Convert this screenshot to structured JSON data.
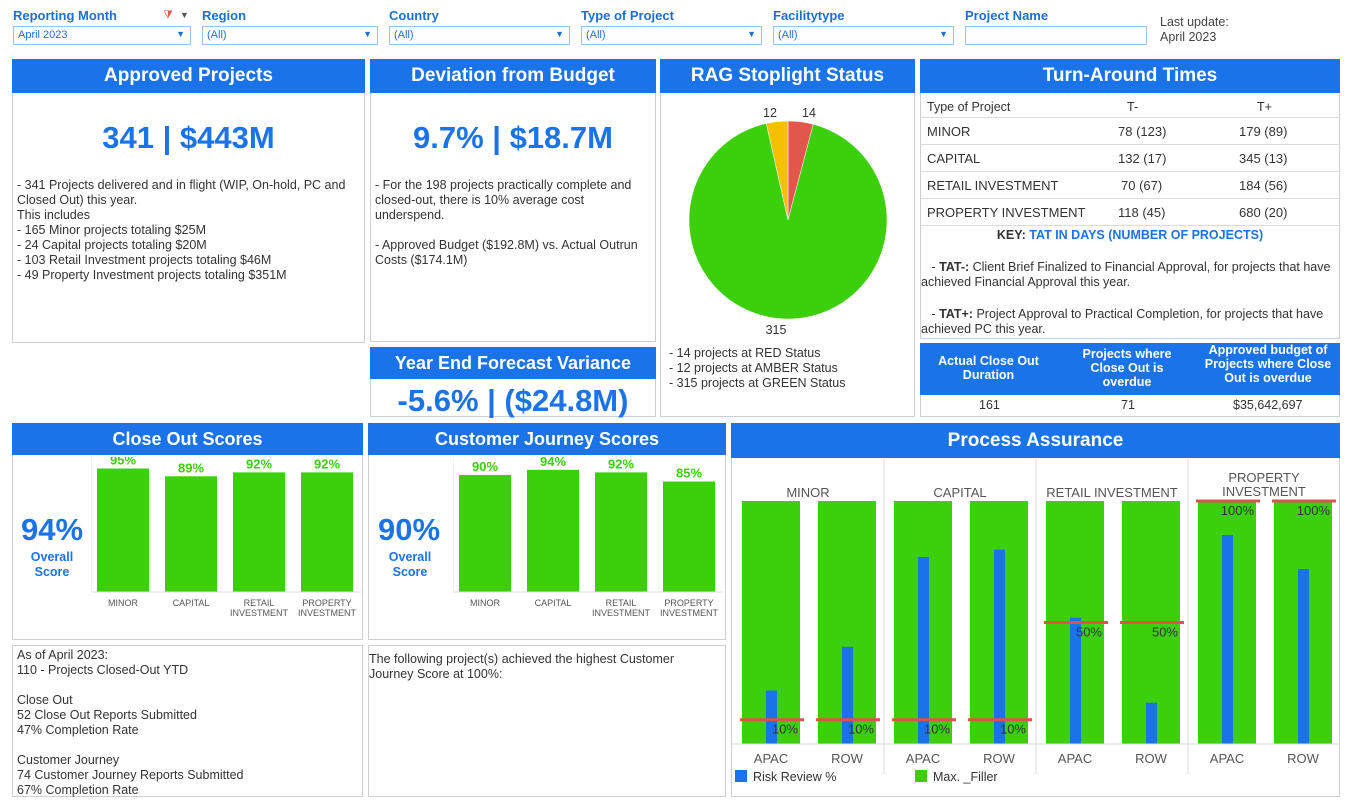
{
  "filters": [
    {
      "label": "Reporting Month",
      "value": "April 2023"
    },
    {
      "label": "Region",
      "value": "(All)"
    },
    {
      "label": "Country",
      "value": "(All)"
    },
    {
      "label": "Type of Project",
      "value": "(All)"
    },
    {
      "label": "Facilitytype",
      "value": "(All)"
    },
    {
      "label": "Project Name",
      "value": ""
    }
  ],
  "last_update": {
    "label": "Last update:",
    "value": "April 2023"
  },
  "approved": {
    "title": "Approved Projects",
    "kpi": "341 | $443M",
    "text": "- 341 Projects delivered and in flight (WIP, On-hold, PC and Closed Out) this year.\n This includes\n- 165 Minor projects totaling $25M\n- 24 Capital projects totaling $20M\n- 103 Retail Investment projects totaling $46M\n- 49 Property Investment projects totaling $351M"
  },
  "deviation": {
    "title": "Deviation from Budget",
    "kpi": "9.7% | $18.7M",
    "text": "- For the 198 projects practically complete and closed-out, there is 10% average cost underspend.\n\n- Approved Budget ($192.8M) vs. Actual Outrun Costs ($174.1M)"
  },
  "forecast": {
    "title": "Year End Forecast Variance",
    "kpi": "-5.6% | ($24.8M)"
  },
  "rag": {
    "title": "RAG Stoplight Status",
    "slices": [
      {
        "label": "RED",
        "value": 14,
        "color": "#e2574c"
      },
      {
        "label": "AMBER",
        "value": 12,
        "color": "#f5c000"
      },
      {
        "label": "GREEN",
        "value": 315,
        "color": "#3ccf0c"
      }
    ],
    "lbl_red": "14",
    "lbl_amber": "12",
    "lbl_green": "315",
    "text": "- 14 projects at RED Status\n- 12 projects at AMBER Status\n- 315 projects at GREEN Status"
  },
  "tat": {
    "title": "Turn-Around Times",
    "headers": [
      "Type of Project",
      "T-",
      "T+"
    ],
    "rows": [
      [
        "MINOR",
        "78 (123)",
        "179 (89)"
      ],
      [
        "CAPITAL",
        "132 (17)",
        "345 (13)"
      ],
      [
        "RETAIL INVESTMENT",
        "70 (67)",
        "184 (56)"
      ],
      [
        "PROPERTY INVESTMENT",
        "118 (45)",
        "680 (20)"
      ]
    ],
    "key_prefix": "KEY:",
    "key_text": "TAT IN DAYS  (NUMBER OF PROJECTS)",
    "note1_bold": "TAT-:",
    "note1": "Client Brief Finalized to Financial Approval, for projects that have achieved Financial Approval this year.",
    "note2_bold": "TAT+:",
    "note2": "Project Approval to Practical Completion, for projects that have achieved PC this year."
  },
  "closeout_table": {
    "headers": [
      "Actual Close Out Duration",
      "Projects where Close Out is overdue",
      "Approved budget of Projects where Close Out is overdue"
    ],
    "values": [
      "161",
      "71",
      "$35,642,697"
    ]
  },
  "closeout_scores": {
    "title": "Close Out Scores",
    "overall": "94%",
    "overall_label": "Overall Score",
    "text": "As of April 2023:\n110 - Projects Closed-Out YTD\n\nClose Out\n52 Close Out Reports Submitted\n47% Completion Rate\n\nCustomer Journey\n74 Customer Journey Reports Submitted\n67% Completion Rate"
  },
  "journey_scores": {
    "title": "Customer Journey Scores",
    "overall": "90%",
    "overall_label": "Overall Score",
    "text": "The following project(s) achieved the  highest Customer Journey Score at 100%:"
  },
  "process": {
    "title": "Process Assurance",
    "legend": [
      {
        "label": "Risk Review %",
        "color": "#1a73e8"
      },
      {
        "label": "Max. _Filler",
        "color": "#3ccf0c"
      }
    ]
  },
  "chart_data": [
    {
      "type": "bar",
      "categories": [
        "MINOR",
        "CAPITAL",
        "RETAIL INVESTMENT",
        "PROPERTY INVESTMENT"
      ],
      "values": [
        95,
        89,
        92,
        92
      ],
      "labels": [
        "95%",
        "89%",
        "92%",
        "92%"
      ],
      "color": "#3ccf0c"
    },
    {
      "type": "bar",
      "categories": [
        "MINOR",
        "CAPITAL",
        "RETAIL INVESTMENT",
        "PROPERTY INVESTMENT"
      ],
      "values": [
        90,
        94,
        92,
        85
      ],
      "labels": [
        "90%",
        "94%",
        "92%",
        "85%"
      ],
      "color": "#3ccf0c"
    },
    {
      "type": "bar",
      "groups": [
        "MINOR",
        "CAPITAL",
        "RETAIL INVESTMENT",
        "PROPERTY INVESTMENT"
      ],
      "group_labels": [
        [
          "MINOR"
        ],
        [
          "CAPITAL"
        ],
        [
          "RETAIL INVESTMENT"
        ],
        [
          "PROPERTY",
          "INVESTMENT"
        ]
      ],
      "categories": [
        "APAC",
        "ROW"
      ],
      "series": [
        {
          "name": "Risk Review %",
          "values": [
            [
              0.22,
              0.4
            ],
            [
              0.77,
              0.8
            ],
            [
              0.52,
              0.17
            ],
            [
              0.86,
              0.72
            ]
          ]
        },
        {
          "name": "Max. _Filler",
          "values": [
            [
              1,
              1
            ],
            [
              1,
              1
            ],
            [
              1,
              1
            ],
            [
              1,
              1
            ]
          ]
        }
      ],
      "reference": [
        0.1,
        0.1,
        0.5,
        1.0
      ],
      "reference_labels": [
        "10%",
        "10%",
        "50%",
        "100%"
      ],
      "ylim": [
        0,
        1
      ]
    }
  ]
}
